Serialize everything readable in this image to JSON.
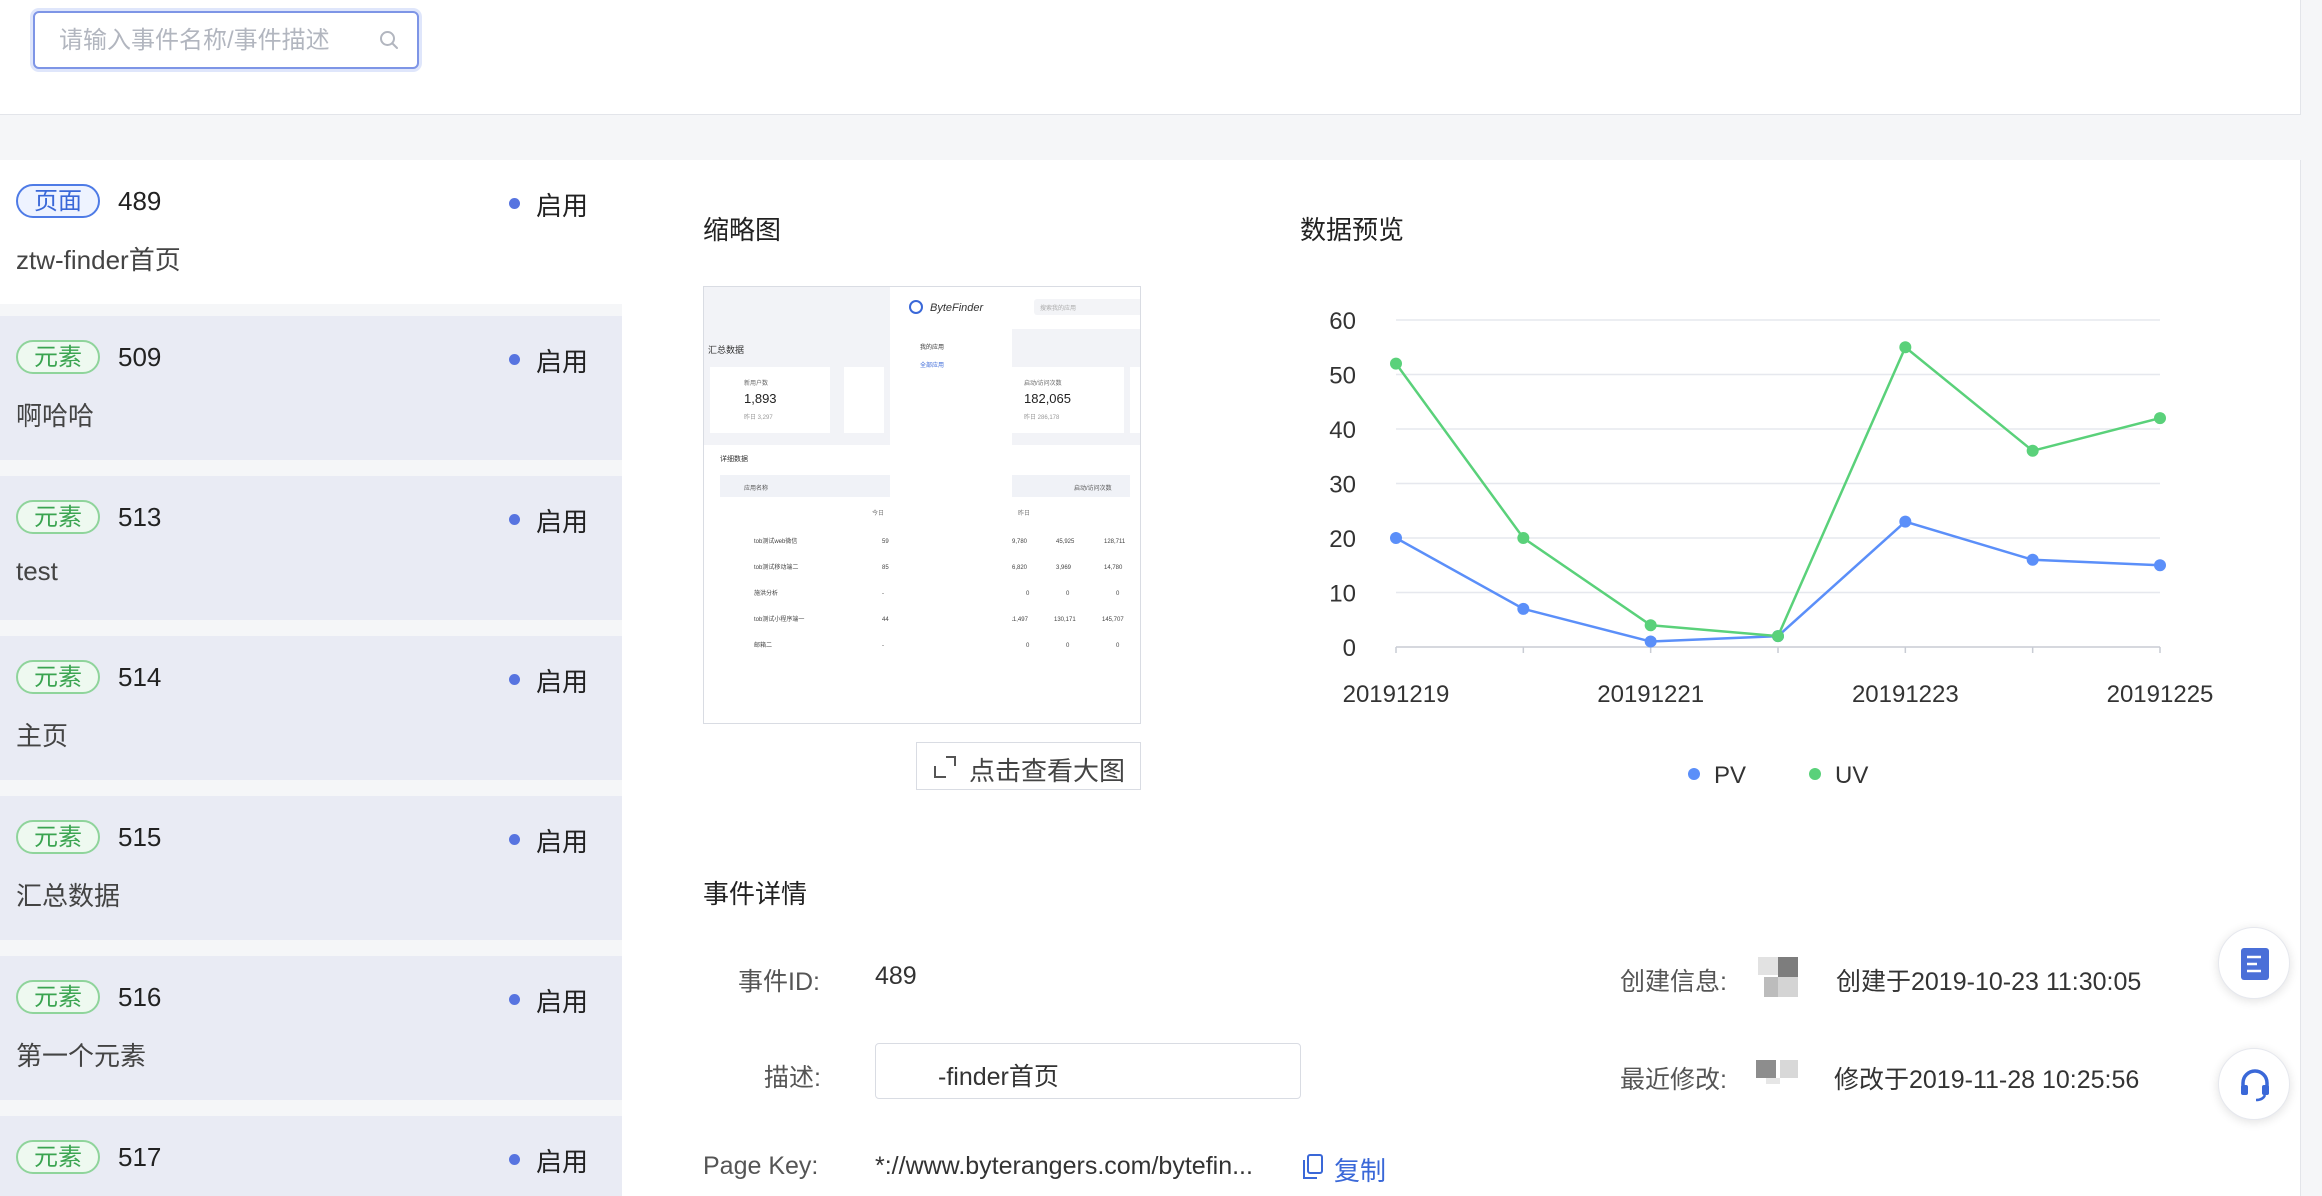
{
  "search": {
    "placeholder": "请输入事件名称/事件描述"
  },
  "list": [
    {
      "tag": "页面",
      "tag_type": "page",
      "id": "489",
      "status": "启用",
      "name": "ztw-finder首页",
      "active": true
    },
    {
      "tag": "元素",
      "tag_type": "element",
      "id": "509",
      "status": "启用",
      "name": "啊哈哈"
    },
    {
      "tag": "元素",
      "tag_type": "element",
      "id": "513",
      "status": "启用",
      "name": "test"
    },
    {
      "tag": "元素",
      "tag_type": "element",
      "id": "514",
      "status": "启用",
      "name": "主页"
    },
    {
      "tag": "元素",
      "tag_type": "element",
      "id": "515",
      "status": "启用",
      "name": "汇总数据"
    },
    {
      "tag": "元素",
      "tag_type": "element",
      "id": "516",
      "status": "启用",
      "name": "第一个元素"
    },
    {
      "tag": "元素",
      "tag_type": "element",
      "id": "517",
      "status": "启用",
      "name": ""
    }
  ],
  "thumbnail": {
    "title": "缩略图",
    "zoom_label": "点击查看大图",
    "brand": "ByteFinder",
    "search_hint": "搜索我的应用",
    "menu_title": "我的应用",
    "menu_item": "全部应用",
    "summary_title": "汇总数据",
    "card1_label": "新用户数",
    "card1_value": "1,893",
    "card1_sub": "昨日 3,297",
    "card2_label": "启动/访问次数",
    "card2_value": "182,065",
    "card2_sub": "昨日 286,178",
    "detail_title": "详细数据",
    "col_app": "应用名称",
    "col_visits": "启动/访问次数",
    "col_today": "今日",
    "col_yesterday": "昨日",
    "rows": [
      {
        "name": "tob测试web微信",
        "a": "59",
        "b": "9,780",
        "c": "45,925",
        "d": "128,711"
      },
      {
        "name": "tob测试移动端二",
        "a": "85",
        "b": "6,820",
        "c": "3,969",
        "d": "14,780"
      },
      {
        "name": "施洪分析",
        "a": "-",
        "b": "0",
        "c": "0",
        "d": "0"
      },
      {
        "name": "tob测试小程序端一",
        "a": "44",
        "b": "11,497",
        "c": "130,171",
        "d": "145,707"
      },
      {
        "name": "邮箱二",
        "a": "-",
        "b": "0",
        "c": "0",
        "d": "0"
      }
    ]
  },
  "preview": {
    "title": "数据预览"
  },
  "chart_data": {
    "type": "line",
    "x": [
      "20191219",
      "20191220",
      "20191221",
      "20191222",
      "20191223",
      "20191224",
      "20191225"
    ],
    "x_tick_labels": [
      "20191219",
      "20191221",
      "20191223",
      "20191225"
    ],
    "ylim": [
      0,
      60
    ],
    "y_ticks": [
      0,
      10,
      20,
      30,
      40,
      50,
      60
    ],
    "grid": true,
    "legend_position": "bottom",
    "series": [
      {
        "name": "PV",
        "color": "#5b8ff9",
        "values": [
          20,
          7,
          1,
          2,
          23,
          16,
          15
        ]
      },
      {
        "name": "UV",
        "color": "#5ad17a",
        "values": [
          52,
          20,
          4,
          2,
          55,
          36,
          42
        ]
      }
    ]
  },
  "details": {
    "title": "事件详情",
    "id_label": "事件ID:",
    "id_value": "489",
    "desc_label": "描述:",
    "desc_value": "-finder首页",
    "pagekey_label": "Page Key:",
    "pagekey_value": "*://www.byterangers.com/bytefin...",
    "copy_label": "复制",
    "created_label": "创建信息:",
    "created_value": "创建于2019-10-23 11:30:05",
    "modified_label": "最近修改:",
    "modified_value": "修改于2019-11-28 10:25:56"
  }
}
